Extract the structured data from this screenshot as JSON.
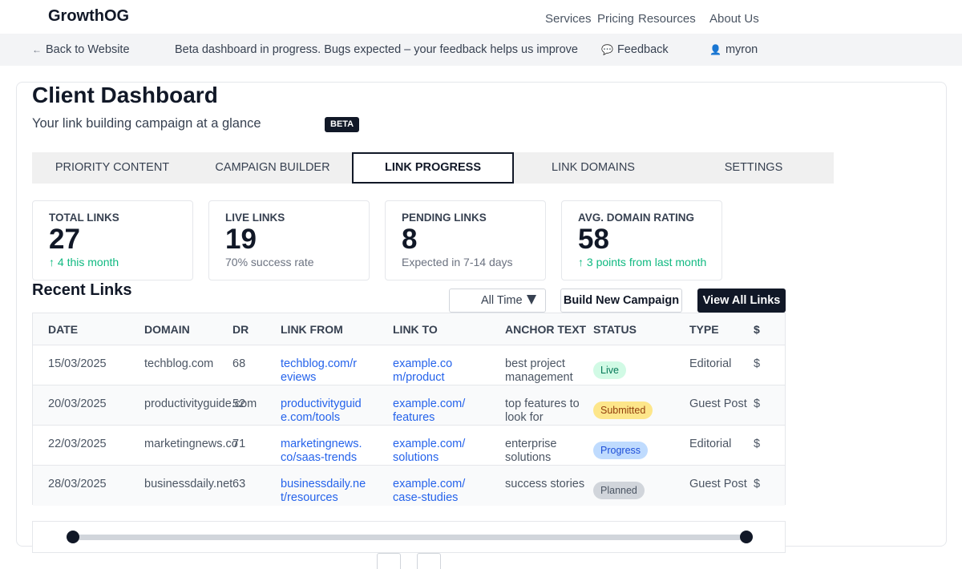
{
  "brand": {
    "name": "GrowthOG"
  },
  "nav": {
    "services": "Services",
    "pricing": "Pricing",
    "resources": "Resources",
    "about": "About Us"
  },
  "beta_bar": {
    "back": "Back to Website",
    "message": "Beta dashboard in progress. Bugs expected – your feedback helps us improve",
    "feedback": "Feedback",
    "user": "myron"
  },
  "header": {
    "title": "Client Dashboard",
    "subtitle": "Your link building campaign at a glance",
    "badge": "BETA"
  },
  "tabs": [
    {
      "label": "PRIORITY CONTENT",
      "active": false
    },
    {
      "label": "CAMPAIGN BUILDER",
      "active": false
    },
    {
      "label": "LINK PROGRESS",
      "active": true
    },
    {
      "label": "LINK DOMAINS",
      "active": false
    },
    {
      "label": "SETTINGS",
      "active": false
    }
  ],
  "stats": [
    {
      "label": "TOTAL LINKS",
      "value": "27",
      "note": "4 this month",
      "trend": "up"
    },
    {
      "label": "LIVE LINKS",
      "value": "19",
      "note": "70% success rate",
      "trend": "none"
    },
    {
      "label": "PENDING LINKS",
      "value": "8",
      "note": "Expected in 7-14 days",
      "trend": "none"
    },
    {
      "label": "AVG. DOMAIN RATING",
      "value": "58",
      "note": "3 points from last month",
      "trend": "up"
    }
  ],
  "recent": {
    "title": "Recent Links",
    "filter": "All Time",
    "build_button": "Build New Campaign",
    "view_button": "View All Links"
  },
  "table": {
    "columns": [
      "DATE",
      "DOMAIN",
      "DR",
      "LINK FROM",
      "LINK TO",
      "ANCHOR TEXT",
      "STATUS",
      "TYPE",
      "$"
    ],
    "rows": [
      {
        "date": "15/03/2025",
        "domain": "techblog.com",
        "dr": "68",
        "from": "techblog.com/reviews",
        "to": "example.com/product",
        "anchor": "best project management",
        "status": "Live",
        "type": "Editorial",
        "price": "$"
      },
      {
        "date": "20/03/2025",
        "domain": "productivityguide.com",
        "dr": "52",
        "from": "productivityguide.com/tools",
        "to": "example.com/features",
        "anchor": "top features to look for",
        "status": "Submitted",
        "type": "Guest Post",
        "price": "$"
      },
      {
        "date": "22/03/2025",
        "domain": "marketingnews.co",
        "dr": "71",
        "from": "marketingnews.co/saas-trends",
        "to": "example.com/solutions",
        "anchor": "enterprise solutions",
        "status": "Progress",
        "type": "Editorial",
        "price": "$"
      },
      {
        "date": "28/03/2025",
        "domain": "businessdaily.net",
        "dr": "63",
        "from": "businessdaily.net/resources",
        "to": "example.com/case-studies",
        "anchor": "success stories",
        "status": "Planned",
        "type": "Guest Post",
        "price": "$"
      }
    ]
  },
  "status_colors": {
    "Live": {
      "bg": "#d1fae5",
      "fg": "#047857"
    },
    "Submitted": {
      "bg": "#fde68a",
      "fg": "#92400e"
    },
    "Progress": {
      "bg": "#bfdbfe",
      "fg": "#1d4ed8"
    },
    "Planned": {
      "bg": "#d1d5db",
      "fg": "#4b5563"
    }
  },
  "icons": {
    "back": "arrow-left-icon",
    "feedback": "speech-bubble-icon",
    "user": "user-icon",
    "trend_up": "arrow-up-icon",
    "filter_caret": "caret-down-icon"
  },
  "range_slider": {
    "min_fraction": 0.0,
    "max_fraction": 1.0
  }
}
